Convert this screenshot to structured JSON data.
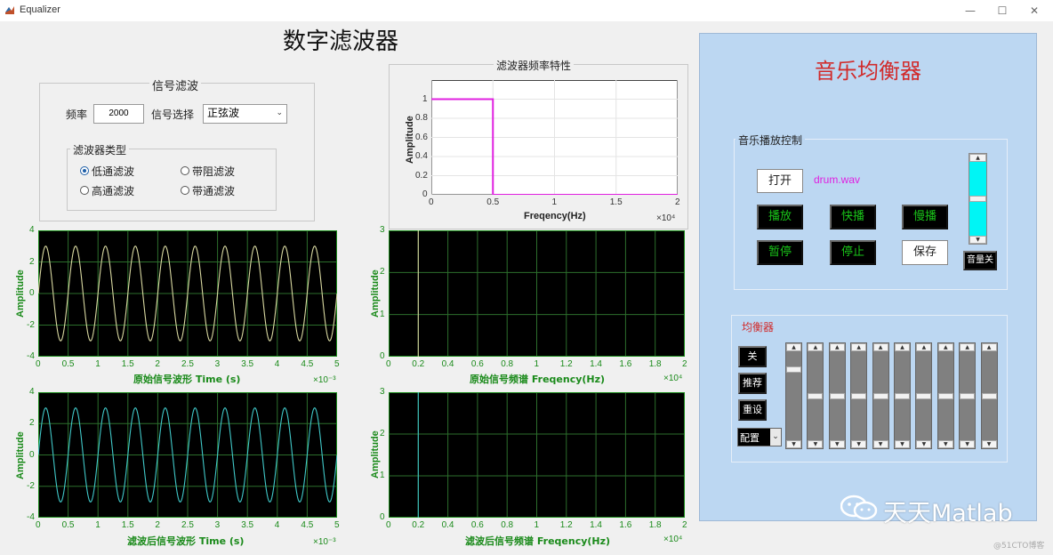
{
  "window": {
    "title": "Equalizer",
    "heading": "数字滤波器",
    "controls": {
      "minimize": "—",
      "maximize": "☐",
      "close": "✕"
    }
  },
  "signal_panel": {
    "title": "信号滤波",
    "freq_label": "频率",
    "freq_value": "2000",
    "signal_select_label": "信号选择",
    "signal_select_value": "正弦波",
    "filter_type": {
      "title": "滤波器类型",
      "options": [
        "低通滤波",
        "带阻滤波",
        "高通滤波",
        "带通滤波"
      ],
      "selected": "低通滤波"
    }
  },
  "response_panel": {
    "title": "滤波器频率特性"
  },
  "chart_data": [
    {
      "type": "line",
      "name": "filter-response",
      "xlabel": "Freqency(Hz)",
      "ylabel": "Amplitude",
      "xlim": [
        0,
        20000
      ],
      "ylim": [
        0,
        1.2
      ],
      "x_ticks": [
        "0",
        "0.5",
        "1",
        "1.5",
        "2"
      ],
      "x_exponent": "×10⁴",
      "y_ticks": [
        "0",
        "0.2",
        "0.4",
        "0.6",
        "0.8",
        "1"
      ],
      "grid": true,
      "series": [
        {
          "color": "#e020e0",
          "x": [
            0,
            5000,
            5000,
            20000
          ],
          "y": [
            1,
            1,
            0,
            0
          ]
        }
      ]
    },
    {
      "type": "line",
      "name": "original-waveform",
      "xlabel": "原始信号波形    Time (s)",
      "ylabel": "Amplitude",
      "xlim": [
        0,
        0.005
      ],
      "ylim": [
        -4,
        4
      ],
      "x_ticks": [
        "0",
        "0.5",
        "1",
        "1.5",
        "2",
        "2.5",
        "3",
        "3.5",
        "4",
        "4.5",
        "5"
      ],
      "x_exponent": "×10⁻³",
      "y_ticks": [
        "-4",
        "-2",
        "0",
        "2",
        "4"
      ],
      "grid": true,
      "series": [
        {
          "color": "#d8d8a0",
          "function": "3*sin(2*pi*2000*t)",
          "amplitude": 3,
          "frequency_hz": 2000
        }
      ]
    },
    {
      "type": "line",
      "name": "original-spectrum",
      "xlabel": "原始信号频谱    Freqency(Hz)",
      "ylabel": "Amplitude",
      "xlim": [
        0,
        20000
      ],
      "ylim": [
        0,
        3
      ],
      "x_ticks": [
        "0",
        "0.2",
        "0.4",
        "0.6",
        "0.8",
        "1",
        "1.2",
        "1.4",
        "1.6",
        "1.8",
        "2"
      ],
      "x_exponent": "×10⁴",
      "y_ticks": [
        "0",
        "1",
        "2",
        "3"
      ],
      "grid": true,
      "series": [
        {
          "color": "#d8d8a0",
          "x": [
            2000,
            2000
          ],
          "y": [
            0,
            3
          ]
        }
      ]
    },
    {
      "type": "line",
      "name": "filtered-waveform",
      "xlabel": "滤波后信号波形    Time (s)",
      "ylabel": "Amplitude",
      "xlim": [
        0,
        0.005
      ],
      "ylim": [
        -4,
        4
      ],
      "x_ticks": [
        "0",
        "0.5",
        "1",
        "1.5",
        "2",
        "2.5",
        "3",
        "3.5",
        "4",
        "4.5",
        "5"
      ],
      "x_exponent": "×10⁻³",
      "y_ticks": [
        "-4",
        "-2",
        "0",
        "2",
        "4"
      ],
      "grid": true,
      "series": [
        {
          "color": "#40c8c8",
          "function": "3*sin(2*pi*2000*t)",
          "amplitude": 3,
          "frequency_hz": 2000
        }
      ]
    },
    {
      "type": "line",
      "name": "filtered-spectrum",
      "xlabel": "滤波后信号频谱    Freqency(Hz)",
      "ylabel": "Amplitude",
      "xlim": [
        0,
        20000
      ],
      "ylim": [
        0,
        3
      ],
      "x_ticks": [
        "0",
        "0.2",
        "0.4",
        "0.6",
        "0.8",
        "1",
        "1.2",
        "1.4",
        "1.6",
        "1.8",
        "2"
      ],
      "x_exponent": "×10⁴",
      "y_ticks": [
        "0",
        "1",
        "2",
        "3"
      ],
      "grid": true,
      "series": [
        {
          "color": "#40c8c8",
          "x": [
            2000,
            2000
          ],
          "y": [
            0,
            3
          ]
        }
      ]
    }
  ],
  "equalizer": {
    "title": "音乐均衡器",
    "playback": {
      "title": "音乐播放控制",
      "open": "打开",
      "filename": "drum.wav",
      "play": "播放",
      "fast": "快播",
      "slow": "慢播",
      "pause": "暂停",
      "stop": "停止",
      "save": "保存",
      "volume_off": "音量关",
      "volume_level": 0.5
    },
    "eq": {
      "title": "均衡器",
      "off": "关",
      "recommend": "推荐",
      "reset": "重设",
      "preset": "配置",
      "band_levels": [
        0.18,
        0.5,
        0.5,
        0.5,
        0.5,
        0.5,
        0.5,
        0.5,
        0.5,
        0.5
      ]
    }
  },
  "watermark": {
    "brand": "天天Matlab",
    "credit": "@51CTO博客"
  },
  "colors": {
    "plot_bg": "#000000",
    "grid": "#2c6e2c",
    "axis_green": "#1a8a1a",
    "eq_panel": "#bcd7f2",
    "title_red": "#d12b2b",
    "slider_cyan": "#00f5f5"
  }
}
